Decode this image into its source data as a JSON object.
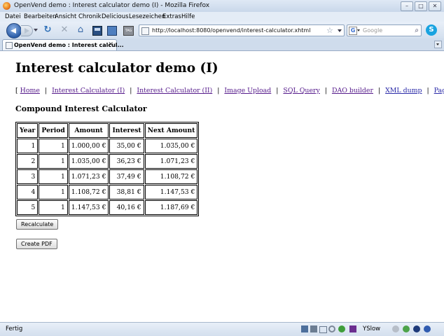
{
  "window": {
    "title": "OpenVend demo : Interest calculator demo (I) - Mozilla Firefox",
    "controls": {
      "minimize": "–",
      "maximize": "□",
      "close": "✕"
    }
  },
  "menu": [
    "Datei",
    "Bearbeiten",
    "Ansicht",
    "Chronik",
    "Delicious",
    "Lesezeichen",
    "Extras",
    "Hilfe"
  ],
  "toolbar": {
    "url": "http://localhost:8080/openvend/interest-calculator.xhtml",
    "search_placeholder": "Google",
    "tag_label": "TAG"
  },
  "tab": {
    "label": "OpenVend demo : Interest calcul...",
    "close": "✕"
  },
  "page": {
    "title": "Interest calculator demo (I)",
    "open_bracket": "[",
    "close_bracket": "]",
    "separator": "|",
    "links": [
      {
        "label": "Home",
        "visited": true
      },
      {
        "label": "Interest Calculator (I)",
        "visited": true
      },
      {
        "label": "Interest Calculator (II)",
        "visited": true
      },
      {
        "label": "Image Upload",
        "visited": true
      },
      {
        "label": "SQL Query",
        "visited": true
      },
      {
        "label": "DAO builder",
        "visited": true
      },
      {
        "label": "XML dump",
        "visited": false
      },
      {
        "label": "Page dump",
        "visited": false
      }
    ],
    "subtitle": "Compound Interest Calculator",
    "table": {
      "headers": [
        "Year",
        "Period",
        "Amount",
        "Interest",
        "Next Amount"
      ],
      "rows": [
        [
          "1",
          "1",
          "1.000,00 €",
          "35,00 €",
          "1.035,00 €"
        ],
        [
          "2",
          "1",
          "1.035,00 €",
          "36,23 €",
          "1.071,23 €"
        ],
        [
          "3",
          "1",
          "1.071,23 €",
          "37,49 €",
          "1.108,72 €"
        ],
        [
          "4",
          "1",
          "1.108,72 €",
          "38,81 €",
          "1.147,53 €"
        ],
        [
          "5",
          "1",
          "1.147,53 €",
          "40,16 €",
          "1.187,69 €"
        ]
      ]
    },
    "buttons": {
      "recalculate": "Recalculate",
      "create_pdf": "Create PDF"
    }
  },
  "status": {
    "text": "Fertig",
    "yslow": "YSlow"
  },
  "colors": {
    "link": "#2a2aa8",
    "visited_link": "#551a8b",
    "chrome": "#d7e3f1"
  }
}
